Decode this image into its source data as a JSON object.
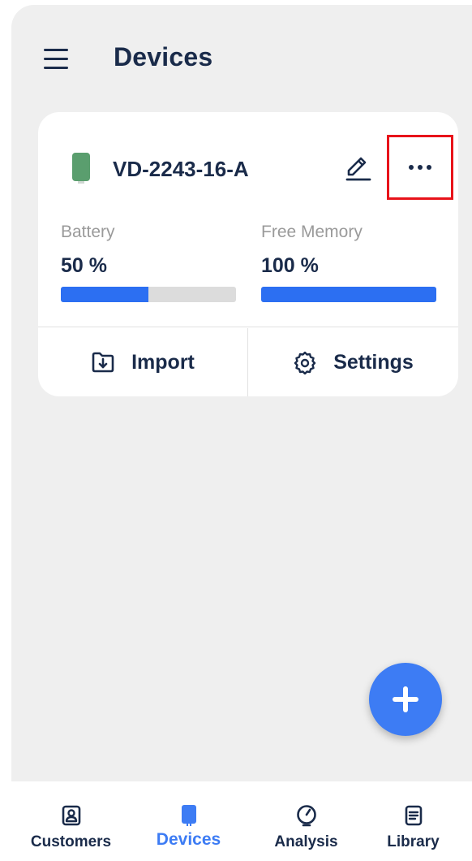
{
  "header": {
    "title": "Devices",
    "menu_icon": "hamburger-menu-icon"
  },
  "device_card": {
    "device_name": "VD-2243-16-A",
    "device_color": "#5a9e6e",
    "battery": {
      "label": "Battery",
      "value_text": "50 %",
      "value": 50
    },
    "memory": {
      "label": "Free Memory",
      "value_text": "100 %",
      "value": 100
    },
    "actions": {
      "import_label": "Import",
      "settings_label": "Settings"
    },
    "icons": {
      "edit": "pencil-icon",
      "more": "more-horizontal-icon",
      "import": "folder-download-icon",
      "settings": "gear-icon"
    }
  },
  "fab": {
    "icon": "plus-icon"
  },
  "bottom_nav": {
    "items": [
      {
        "label": "Customers",
        "icon": "customer-card-icon",
        "active": false
      },
      {
        "label": "Devices",
        "icon": "device-icon",
        "active": true
      },
      {
        "label": "Analysis",
        "icon": "gauge-icon",
        "active": false
      },
      {
        "label": "Library",
        "icon": "document-list-icon",
        "active": false
      }
    ]
  },
  "colors": {
    "primary": "#3d7cf4",
    "progress": "#2c6ff2",
    "text": "#1a2b4a",
    "highlight": "#e8131a",
    "background": "#efefef"
  }
}
